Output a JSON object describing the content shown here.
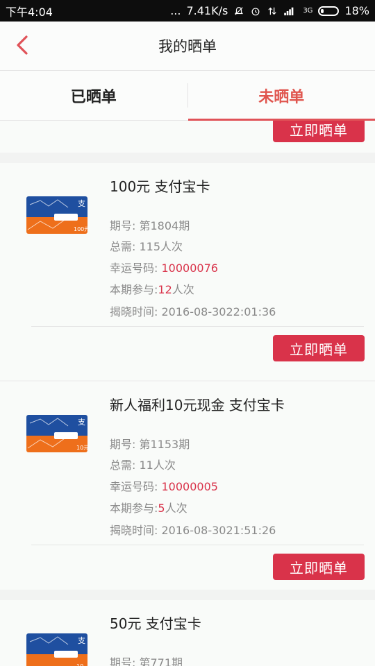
{
  "status_bar": {
    "time": "下午4:04",
    "dots": "...",
    "speed": "7.41K/s",
    "network": "3G",
    "battery": "18%"
  },
  "header": {
    "back_icon": "chevron-left-icon",
    "title": "我的晒单"
  },
  "tabs": [
    {
      "label": "已晒单",
      "active": false
    },
    {
      "label": "未晒单",
      "active": true
    }
  ],
  "orders": [
    {
      "title": "100元 支付宝卡",
      "period_label": "期号: ",
      "period": "第1804期",
      "total_label": "总需: ",
      "total": "115人次",
      "lucky_label": "幸运号码: ",
      "lucky_code": "10000076",
      "participate_label": "本期参与:",
      "participate_count": "12",
      "participate_unit": "人次",
      "reveal_label": "揭晓时间: ",
      "reveal_time": "2016-08-3022:01:36",
      "card_value": "100元",
      "button": "立即晒单"
    },
    {
      "title": "新人福利10元现金 支付宝卡",
      "period_label": "期号: ",
      "period": "第1153期",
      "total_label": "总需: ",
      "total": "11人次",
      "lucky_label": "幸运号码: ",
      "lucky_code": "10000005",
      "participate_label": "本期参与:",
      "participate_count": "5",
      "participate_unit": "人次",
      "reveal_label": "揭晓时间: ",
      "reveal_time": "2016-08-3021:51:26",
      "card_value": "10元",
      "button": "立即晒单"
    },
    {
      "title": "50元 支付宝卡",
      "period_label": "期号: ",
      "period": "第771期",
      "card_value": "10"
    }
  ],
  "top_partial_button": "立即晒单",
  "colors": {
    "accent": "#d9334a",
    "tab_active": "#e0564f",
    "card_blue": "#1f4fa0",
    "card_orange": "#ee6f1b"
  }
}
